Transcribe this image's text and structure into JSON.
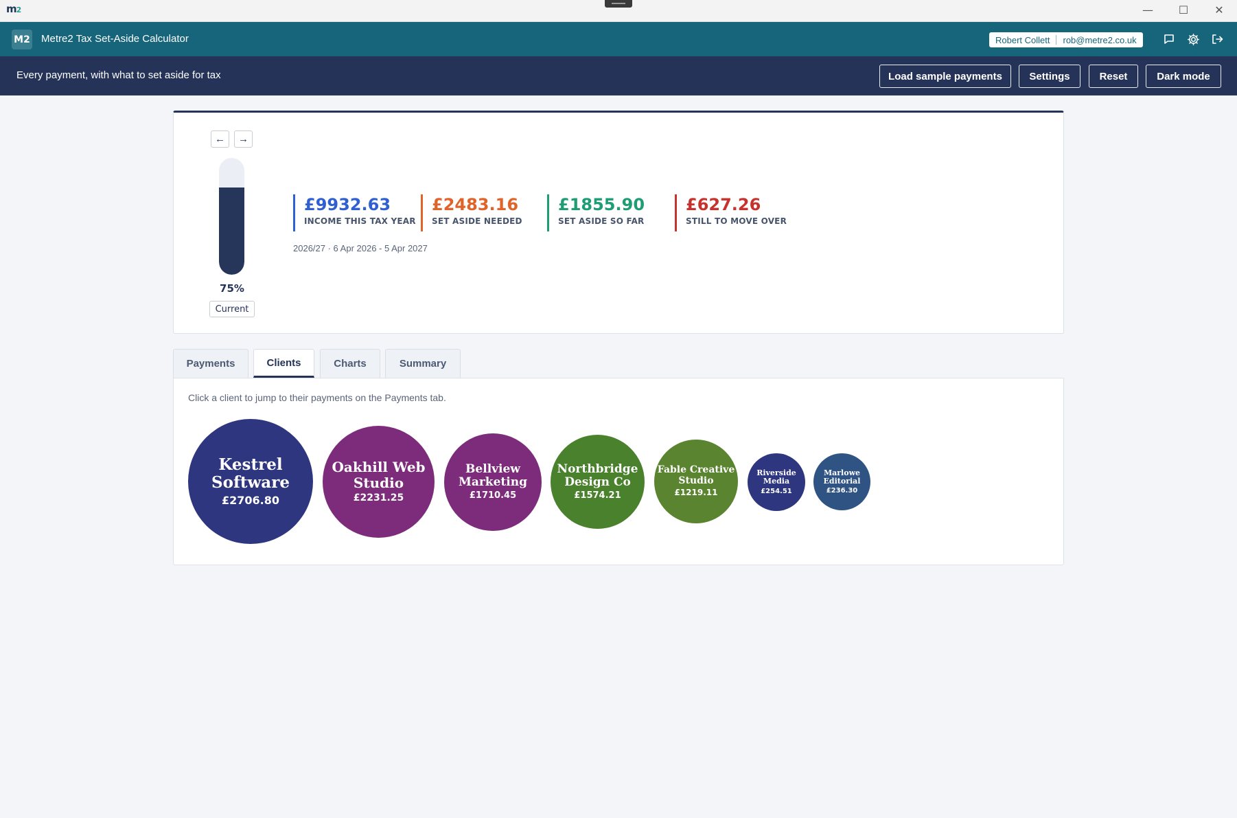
{
  "window": {
    "logo_main": "m",
    "logo_sup": "2",
    "minimize": "—",
    "maximize": "☐",
    "close": "✕"
  },
  "header": {
    "badge": "M2",
    "title": "Metre2 Tax Set-Aside Calculator",
    "user_name": "Robert Collett",
    "user_email": "rob@metre2.co.uk"
  },
  "toolbar": {
    "tagline": "Every payment, with what to set aside for tax",
    "load_sample": "Load sample payments",
    "settings": "Settings",
    "reset": "Reset",
    "dark_mode": "Dark mode"
  },
  "summary": {
    "prev": "←",
    "next": "→",
    "progress_percent": 75,
    "progress_label": "75%",
    "current_button": "Current",
    "stats": [
      {
        "value": "£9932.63",
        "label": "INCOME THIS TAX YEAR",
        "color": "#2f5fd0"
      },
      {
        "value": "£2483.16",
        "label": "SET ASIDE NEEDED",
        "color": "#e0632a"
      },
      {
        "value": "£1855.90",
        "label": "SET ASIDE SO FAR",
        "color": "#1e9c74"
      },
      {
        "value": "£627.26",
        "label": "STILL TO MOVE OVER",
        "color": "#c6322c"
      }
    ],
    "period": "2026/27 · 6 Apr 2026 - 5 Apr 2027"
  },
  "tabs": [
    {
      "label": "Payments"
    },
    {
      "label": "Clients"
    },
    {
      "label": "Charts"
    },
    {
      "label": "Summary"
    }
  ],
  "clients_panel": {
    "hint": "Click a client to jump to their payments on the Payments tab.",
    "clients": [
      {
        "name_line1": "Kestrel",
        "name_line2": "Software",
        "amount": "£2706.80",
        "color": "#2d367e"
      },
      {
        "name_line1": "Oakhill Web",
        "name_line2": "Studio",
        "amount": "£2231.25",
        "color": "#7d2b7b"
      },
      {
        "name_line1": "Bellview",
        "name_line2": "Marketing",
        "amount": "£1710.45",
        "color": "#7d2b7b"
      },
      {
        "name_line1": "Northbridge",
        "name_line2": "Design Co",
        "amount": "£1574.21",
        "color": "#4a812d"
      },
      {
        "name_line1": "Fable Creative",
        "name_line2": "Studio",
        "amount": "£1219.11",
        "color": "#5a842f"
      },
      {
        "name_line1": "Riverside",
        "name_line2": "Media",
        "amount": "£254.51",
        "color": "#2d367e"
      },
      {
        "name_line1": "Marlowe",
        "name_line2": "Editorial",
        "amount": "£236.30",
        "color": "#2f5383"
      }
    ]
  },
  "colors": {
    "appbar": "#17657a",
    "toolbar": "#253358",
    "accent": "#253358"
  }
}
